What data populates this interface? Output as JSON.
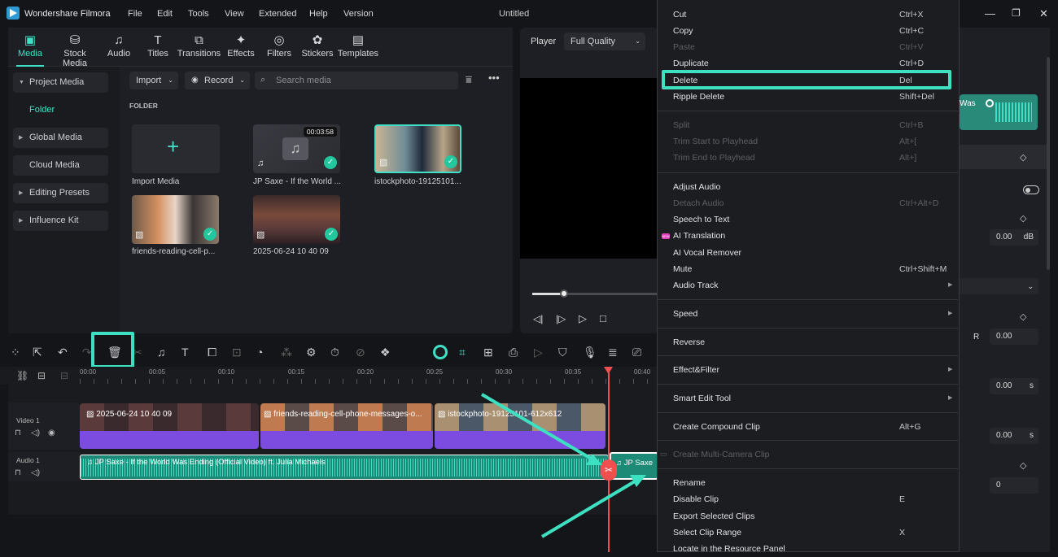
{
  "app": {
    "name": "Wondershare Filmora",
    "project_title": "Untitled",
    "menus": [
      "File",
      "Edit",
      "Tools",
      "View",
      "Extended",
      "Help",
      "Version"
    ]
  },
  "nav_tabs": [
    {
      "label": "Media",
      "icon": "media-icon"
    },
    {
      "label": "Stock Media",
      "icon": "stock-media-icon"
    },
    {
      "label": "Audio",
      "icon": "audio-icon"
    },
    {
      "label": "Titles",
      "icon": "titles-icon"
    },
    {
      "label": "Transitions",
      "icon": "transitions-icon"
    },
    {
      "label": "Effects",
      "icon": "effects-icon"
    },
    {
      "label": "Filters",
      "icon": "filters-icon"
    },
    {
      "label": "Stickers",
      "icon": "stickers-icon"
    },
    {
      "label": "Templates",
      "icon": "templates-icon"
    }
  ],
  "sidebar": {
    "project_media": "Project Media",
    "folder": "Folder",
    "global_media": "Global Media",
    "cloud_media": "Cloud Media",
    "editing_presets": "Editing Presets",
    "influence_kit": "Influence Kit"
  },
  "media_toolbar": {
    "import": "Import",
    "record": "Record",
    "search_placeholder": "Search media"
  },
  "folder_heading": "FOLDER",
  "media_items": {
    "import": "Import Media",
    "audio": "JP Saxe - If the World ...",
    "audio_duration": "00:03:58",
    "img1": "istockphoto-19125101...",
    "img2": "friends-reading-cell-p...",
    "img3": "2025-06-24 10 40 09"
  },
  "player": {
    "label": "Player",
    "quality": "Full Quality",
    "progress": 0.25
  },
  "ruler": [
    "00:00",
    "00:05",
    "00:10",
    "00:15",
    "00:20",
    "00:25",
    "00:30",
    "00:35",
    "00:40"
  ],
  "tracks": {
    "video_label": "Video 1",
    "audio_label": "Audio 1",
    "clip1": "2025-06-24 10 40 09",
    "clip2": "friends-reading-cell-phone-messages-o...",
    "clip3": "istockphoto-19125101-612x612",
    "audio_clip": "JP Saxe - If the World Was Ending (Official Video) ft. Julia Michaels",
    "audio_clip2": "JP Saxe"
  },
  "context_menu": [
    {
      "label": "Cut",
      "shortcut": "Ctrl+X",
      "enabled": true
    },
    {
      "label": "Copy",
      "shortcut": "Ctrl+C",
      "enabled": true
    },
    {
      "label": "Paste",
      "shortcut": "Ctrl+V",
      "enabled": false
    },
    {
      "label": "Duplicate",
      "shortcut": "Ctrl+D",
      "enabled": true
    },
    {
      "label": "Delete",
      "shortcut": "Del",
      "enabled": true
    },
    {
      "label": "Ripple Delete",
      "shortcut": "Shift+Del",
      "enabled": true
    },
    {
      "label": "Split",
      "shortcut": "Ctrl+B",
      "enabled": false
    },
    {
      "label": "Trim Start to Playhead",
      "shortcut": "Alt+[",
      "enabled": false
    },
    {
      "label": "Trim End to Playhead",
      "shortcut": "Alt+]",
      "enabled": false
    },
    {
      "label": "Adjust Audio",
      "shortcut": "",
      "enabled": true
    },
    {
      "label": "Detach Audio",
      "shortcut": "Ctrl+Alt+D",
      "enabled": false
    },
    {
      "label": "Speech to Text",
      "shortcut": "",
      "enabled": true
    },
    {
      "label": "AI Translation",
      "shortcut": "",
      "enabled": true,
      "badge": "NEW"
    },
    {
      "label": "AI Vocal Remover",
      "shortcut": "",
      "enabled": true
    },
    {
      "label": "Mute",
      "shortcut": "Ctrl+Shift+M",
      "enabled": true
    },
    {
      "label": "Audio Track",
      "shortcut": "",
      "enabled": true
    },
    {
      "label": "Speed",
      "shortcut": "",
      "enabled": true
    },
    {
      "label": "Reverse",
      "shortcut": "",
      "enabled": true
    },
    {
      "label": "Effect&Filter",
      "shortcut": "",
      "enabled": true
    },
    {
      "label": "Smart Edit Tool",
      "shortcut": "",
      "enabled": true
    },
    {
      "label": "Create Compound Clip",
      "shortcut": "Alt+G",
      "enabled": true
    },
    {
      "label": "Create Multi-Camera Clip",
      "shortcut": "",
      "enabled": false
    },
    {
      "label": "Rename",
      "shortcut": "",
      "enabled": true
    },
    {
      "label": "Disable Clip",
      "shortcut": "E",
      "enabled": true
    },
    {
      "label": "Export Selected Clips",
      "shortcut": "",
      "enabled": true
    },
    {
      "label": "Select Clip Range",
      "shortcut": "X",
      "enabled": true
    },
    {
      "label": "Locate in the Resource Panel",
      "shortcut": "",
      "enabled": true
    }
  ],
  "properties": {
    "clip_title": "Was",
    "v1": "0.00",
    "unit_db": "dB",
    "r_label": "R",
    "v2": "0.00",
    "v3": "0.00",
    "unit_s": "s",
    "v4": "0.00",
    "unit_s2": "s",
    "v5": "0"
  },
  "colors": {
    "accent": "#3fe0c5",
    "highlight_box": "#3de0c0",
    "video_clip": "#7c4ce0",
    "audio_clip": "#28b39a",
    "playhead": "#ef4f4f",
    "arrow": "#3de0c0"
  }
}
